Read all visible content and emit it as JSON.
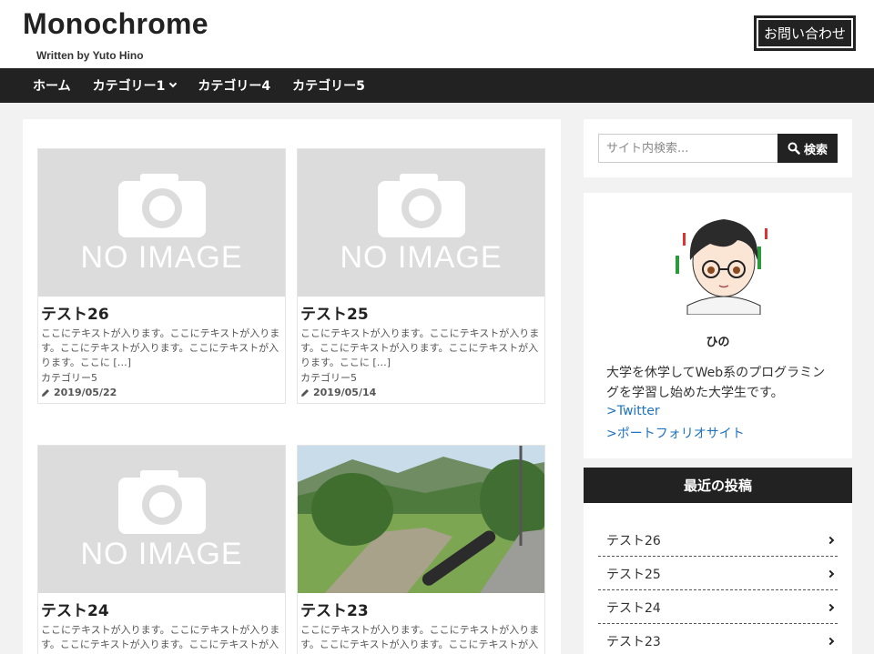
{
  "header": {
    "site_title": "Monochrome",
    "site_subtitle": "Written by Yuto Hino",
    "contact_label": "お問い合わせ"
  },
  "nav": {
    "items": [
      {
        "label": "ホーム",
        "has_dropdown": false
      },
      {
        "label": "カテゴリー1",
        "has_dropdown": true
      },
      {
        "label": "カテゴリー4",
        "has_dropdown": false
      },
      {
        "label": "カテゴリー5",
        "has_dropdown": false
      }
    ]
  },
  "posts": [
    {
      "title": "テスト26",
      "thumb": "no-image",
      "thumb_text": "NO IMAGE",
      "excerpt": "ここにテキストが入ります。ここにテキストが入ります。ここにテキストが入ります。ここにテキストが入ります。ここに […]",
      "category": "カテゴリー5",
      "date": "2019/05/22"
    },
    {
      "title": "テスト25",
      "thumb": "no-image",
      "thumb_text": "NO IMAGE",
      "excerpt": "ここにテキストが入ります。ここにテキストが入ります。ここにテキストが入ります。ここにテキストが入ります。ここに […]",
      "category": "カテゴリー5",
      "date": "2019/05/14"
    },
    {
      "title": "テスト24",
      "thumb": "no-image",
      "thumb_text": "NO IMAGE",
      "excerpt": "ここにテキストが入ります。ここにテキストが入ります。ここにテキストが入ります。ここにテキストが入ります。ここに […]",
      "category": "",
      "date": ""
    },
    {
      "title": "テスト23",
      "thumb": "landscape-photo",
      "thumb_text": "",
      "excerpt": "ここにテキストが入ります。ここにテキストが入ります。ここにテキストが入ります。ここにテキストが入ります。ここに […]",
      "category": "",
      "date": ""
    }
  ],
  "sidebar": {
    "search": {
      "placeholder": "サイト内検索...",
      "button_label": "検索"
    },
    "profile": {
      "name": "ひの",
      "bio": "大学を休学してWeb系のプログラミングを学習し始めた大学生です。",
      "links": [
        ">Twitter",
        ">ポートフォリオサイト"
      ]
    },
    "recent": {
      "heading": "最近の投稿",
      "items": [
        "テスト26",
        "テスト25",
        "テスト24",
        "テスト23"
      ]
    }
  },
  "colors": {
    "dark": "#222222",
    "link": "#1e73be",
    "placeholder_bg": "#dcdcdc",
    "page_bg": "#f2f2f2"
  }
}
